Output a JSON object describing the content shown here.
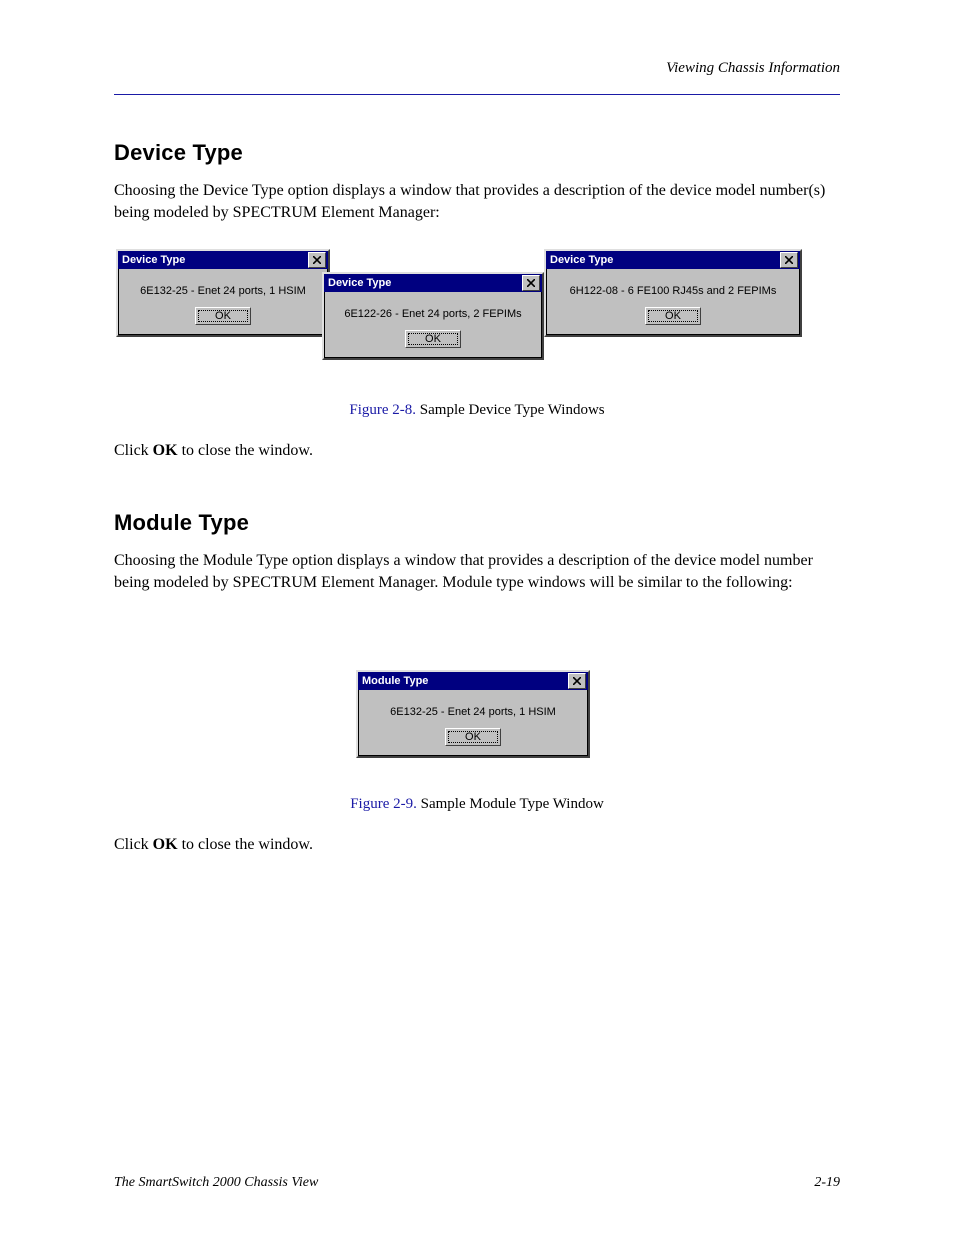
{
  "header": {
    "running": "Viewing Chassis Information"
  },
  "sections": {
    "device_type": {
      "title": "Device Type",
      "lead": "Choosing the Device Type option displays a window that provides a description of the device model number(s) being modeled by SPECTRUM Element Manager:"
    },
    "module_type": {
      "title": "Module Type",
      "lead": "Choosing the Module Type option displays a window that provides a description of the device model number being modeled by SPECTRUM Element Manager. Module type windows will be similar to the following:"
    }
  },
  "figures": {
    "f2_8": {
      "number": "Figure 2-8.",
      "caption": " Sample Device Type Windows",
      "button": "OK",
      "close_icon": "close-icon",
      "dialogs": [
        {
          "title": "Device Type",
          "message": "6E132-25 - Enet 24 ports, 1 HSIM"
        },
        {
          "title": "Device Type",
          "message": "6E122-26 - Enet 24 ports, 2 FEPIMs"
        },
        {
          "title": "Device Type",
          "message": "6H122-08 - 6 FE100 RJ45s and 2 FEPIMs"
        }
      ]
    },
    "f2_9": {
      "number": "Figure 2-9.",
      "caption": " Sample Module Type Window",
      "button": "OK",
      "close_icon": "close-icon",
      "dialog": {
        "title": "Module Type",
        "message": "6E132-25 - Enet 24 ports, 1 HSIM"
      }
    }
  },
  "footer": {
    "left": "The SmartSwitch 2000 Chassis View",
    "right": "2-19"
  }
}
